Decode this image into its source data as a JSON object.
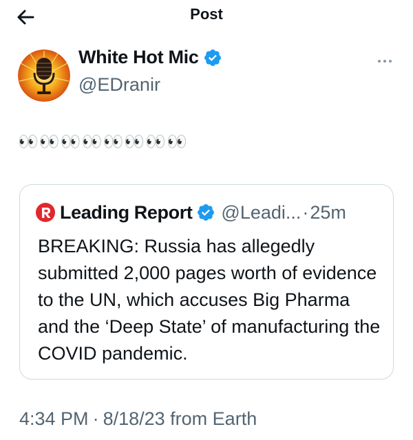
{
  "header": {
    "title": "Post",
    "back_icon": "arrow-left-icon"
  },
  "author": {
    "display_name": "White Hot Mic",
    "handle": "@EDranir",
    "avatar_icon": "microphone-logo",
    "verified_icon": "verified-badge-icon",
    "more_icon": "more-horizontal-icon"
  },
  "tweet": {
    "text": "👀👀👀👀👀👀👀👀"
  },
  "quote": {
    "logo_icon": "leading-report-logo",
    "name": "Leading Report",
    "handle": "@Leadi...",
    "separator": "·",
    "time": "25m",
    "text": "BREAKING: Russia has allegedly submitted 2,000 pages worth of evidence to the UN, which accuses Big Pharma and the ‘Deep State’ of manufacturing the COVID pandemic."
  },
  "meta": {
    "time": "4:34 PM",
    "separator": "·",
    "date": "8/18/23",
    "source": "from Earth"
  },
  "colors": {
    "verified": "#1d9bf0",
    "secondary_text": "#536471",
    "border": "#cfd9de",
    "logo_red": "#e0282f"
  }
}
